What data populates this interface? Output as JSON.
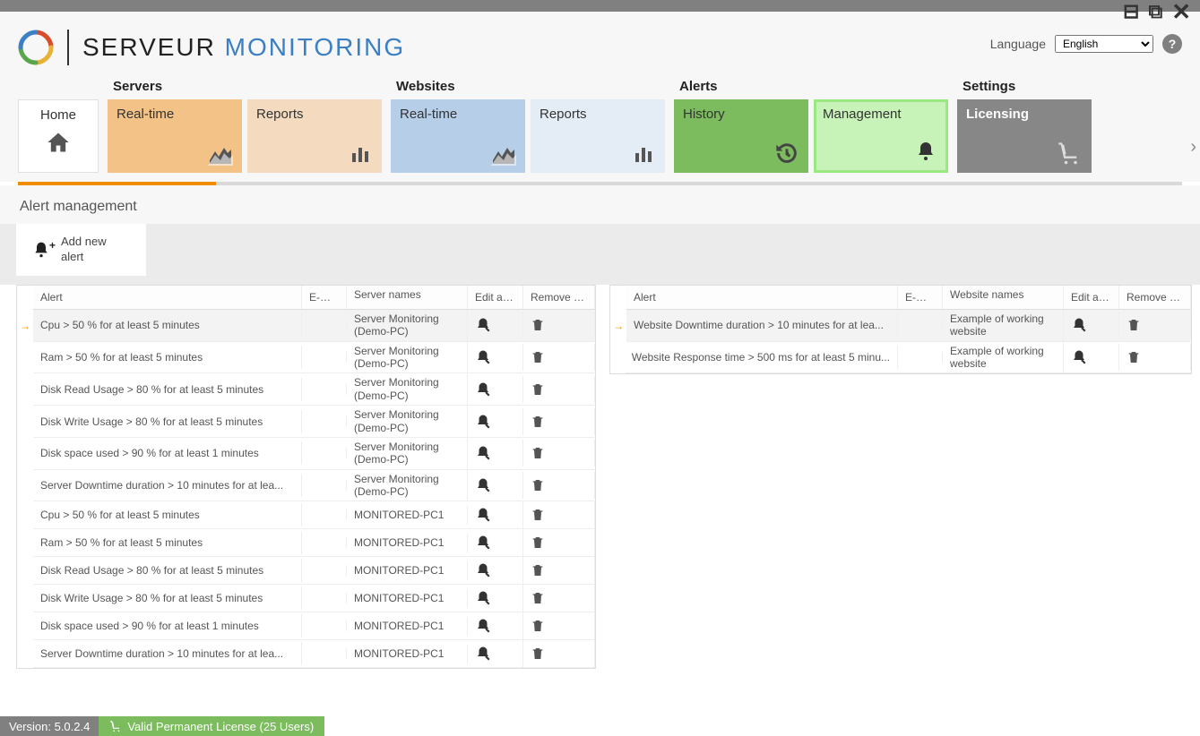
{
  "app": {
    "title1": "SERVEUR ",
    "title2": "MONITORING"
  },
  "header": {
    "language_label": "Language",
    "language_value": "English",
    "help": "?"
  },
  "nav": {
    "home": "Home",
    "groups": [
      {
        "label": "Servers",
        "tiles": [
          {
            "label": "Real-time",
            "cls": "orange1",
            "icon": "chart-broken"
          },
          {
            "label": "Reports",
            "cls": "orange2",
            "icon": "bars"
          }
        ]
      },
      {
        "label": "Websites",
        "tiles": [
          {
            "label": "Real-time",
            "cls": "blue1",
            "icon": "chart-broken"
          },
          {
            "label": "Reports",
            "cls": "blue2",
            "icon": "bars"
          }
        ]
      },
      {
        "label": "Alerts",
        "tiles": [
          {
            "label": "History",
            "cls": "green1",
            "icon": "history"
          },
          {
            "label": "Management",
            "cls": "green2",
            "icon": "bell"
          }
        ]
      },
      {
        "label": "Settings",
        "tiles": [
          {
            "label": "Licensing",
            "cls": "gray1",
            "icon": "cart"
          }
        ]
      }
    ]
  },
  "section": {
    "title": "Alert management",
    "add_label": "Add new alert"
  },
  "cols_server": {
    "alert": "Alert",
    "email": "E-mail",
    "names": "Server names",
    "edit": "Edit alert",
    "remove": "Remove alert"
  },
  "cols_website": {
    "alert": "Alert",
    "email": "E-mail",
    "names": "Website names",
    "edit": "Edit alert",
    "remove": "Remove alert"
  },
  "server_alerts": [
    {
      "alert": "Cpu > 50 % for at least 5 minutes",
      "server": "Server Monitoring (Demo-PC)",
      "sel": true
    },
    {
      "alert": "Ram > 50 % for at least 5 minutes",
      "server": "Server Monitoring (Demo-PC)"
    },
    {
      "alert": "Disk Read Usage > 80 % for at least 5 minutes",
      "server": "Server Monitoring (Demo-PC)"
    },
    {
      "alert": "Disk Write Usage > 80 % for at least 5 minutes",
      "server": "Server Monitoring (Demo-PC)"
    },
    {
      "alert": "Disk space used > 90 % for at least 1 minutes",
      "server": "Server Monitoring (Demo-PC)"
    },
    {
      "alert": "Server Downtime duration > 10 minutes for at lea...",
      "server": "Server Monitoring (Demo-PC)"
    },
    {
      "alert": "Cpu > 50 % for at least 5 minutes",
      "server": "MONITORED-PC1"
    },
    {
      "alert": "Ram > 50 % for at least 5 minutes",
      "server": "MONITORED-PC1"
    },
    {
      "alert": "Disk Read Usage > 80 % for at least 5 minutes",
      "server": "MONITORED-PC1"
    },
    {
      "alert": "Disk Write Usage > 80 % for at least 5 minutes",
      "server": "MONITORED-PC1"
    },
    {
      "alert": "Disk space used > 90 % for at least 1 minutes",
      "server": "MONITORED-PC1"
    },
    {
      "alert": "Server Downtime duration > 10 minutes for at lea...",
      "server": "MONITORED-PC1"
    }
  ],
  "website_alerts": [
    {
      "alert": "Website Downtime duration > 10 minutes for at lea...",
      "website": "Example of working website",
      "sel": true
    },
    {
      "alert": "Website Response time > 500 ms for at least 5 minu...",
      "website": "Example of working website"
    }
  ],
  "status": {
    "version": "Version: 5.0.2.4",
    "license": "Valid Permanent License (25 Users)"
  }
}
